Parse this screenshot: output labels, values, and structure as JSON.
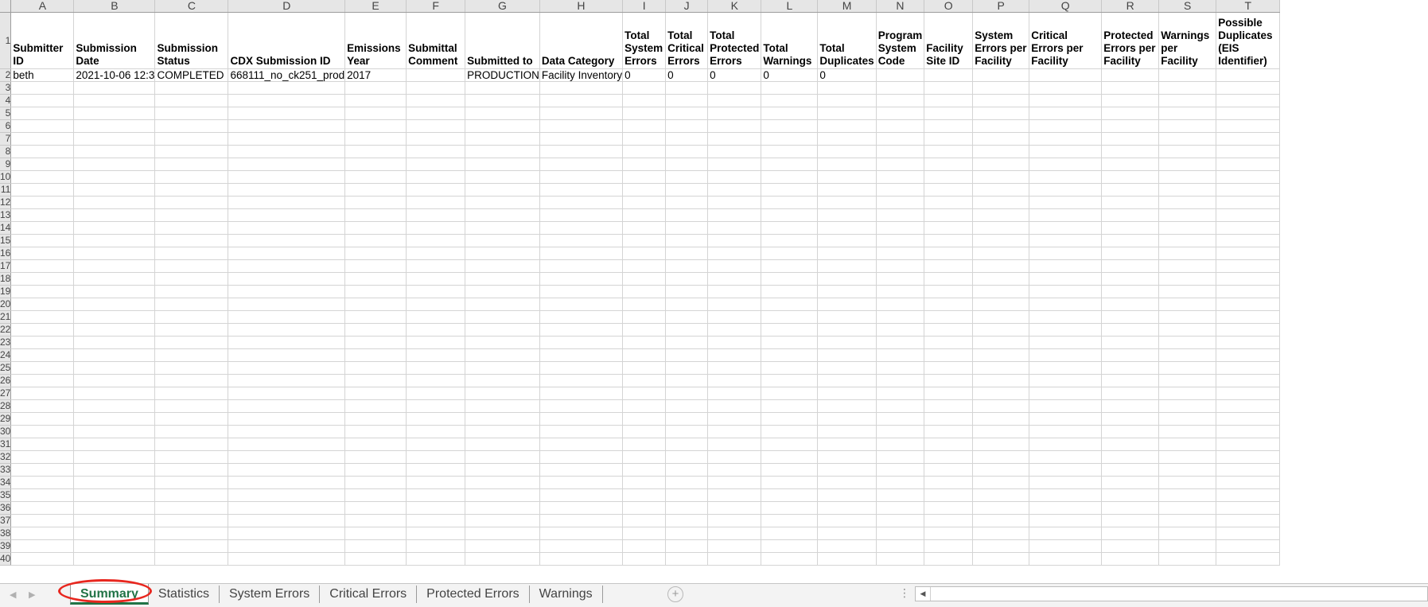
{
  "columns": [
    "A",
    "B",
    "C",
    "D",
    "E",
    "F",
    "G",
    "H",
    "I",
    "J",
    "K",
    "L",
    "M",
    "N",
    "O",
    "P",
    "Q",
    "R",
    "S",
    "T"
  ],
  "row_numbers": [
    "1",
    "2",
    "3",
    "4",
    "5",
    "6",
    "7",
    "8",
    "9",
    "10",
    "11",
    "12",
    "13",
    "14",
    "15",
    "16",
    "17",
    "18",
    "19",
    "20",
    "21",
    "22",
    "23",
    "24",
    "25",
    "26",
    "27",
    "28",
    "29",
    "30",
    "31",
    "32",
    "33",
    "34",
    "35",
    "36",
    "37",
    "38",
    "39",
    "40"
  ],
  "headers": [
    "Submitter ID",
    "Submission Date",
    "Submission Status",
    "CDX Submission ID",
    "Emissions Year",
    "Submittal Comment",
    "Submitted to",
    "Data Category",
    "Total System Errors",
    "Total Critical Errors",
    "Total Protected Errors",
    "Total Warnings",
    "Total Duplicates",
    "Program System Code",
    "Facility Site ID",
    "System Errors per Facility",
    "Critical Errors per Facility",
    "Protected Errors per Facility",
    "Warnings per Facility",
    "Possible Duplicates (EIS Identifier)"
  ],
  "data_rows": [
    [
      "beth",
      "2021-10-06 12:3",
      "COMPLETED",
      "668111_no_ck251_prod",
      "2017",
      "",
      "PRODUCTION",
      "Facility Inventory",
      "0",
      "0",
      "0",
      "0",
      "0",
      "",
      "",
      "",
      "",
      "",
      "",
      ""
    ]
  ],
  "tabs": {
    "items": [
      "Summary",
      "Statistics",
      "System Errors",
      "Critical Errors",
      "Protected Errors",
      "Warnings"
    ],
    "active": "Summary",
    "add_label": "+",
    "nav_prev": "◀",
    "nav_next": "▶",
    "more": "⋮"
  },
  "annotation": {
    "color": "#e8271f",
    "target": "Summary"
  },
  "colors": {
    "active_tab": "#217346",
    "header_bg": "#e6e6e6",
    "gridline": "#d4d4d4"
  }
}
